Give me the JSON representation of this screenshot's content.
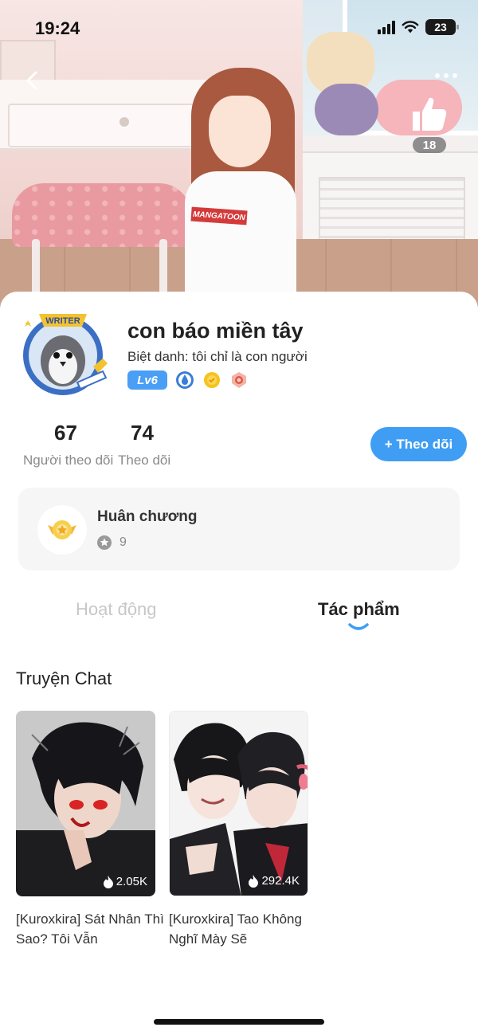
{
  "status_bar": {
    "time": "19:24",
    "battery": "23"
  },
  "header": {
    "like_count": "18"
  },
  "profile": {
    "name": "con báo miền tây",
    "alias": "Biệt danh: tôi chỉ là con người",
    "level": "Lv6",
    "avatar_badge": "WRITER",
    "shirt_text": "MANGATOON"
  },
  "stats": [
    {
      "value": "67",
      "label": "Người theo dõi"
    },
    {
      "value": "74",
      "label": "Theo dõi"
    }
  ],
  "follow_button": "+ Theo dõi",
  "medals": {
    "title": "Huân chương",
    "count": "9"
  },
  "tabs": [
    {
      "label": "Hoạt động",
      "active": false
    },
    {
      "label": "Tác phẩm",
      "active": true
    }
  ],
  "section": {
    "title": "Truyện Chat"
  },
  "works": [
    {
      "title": "[Kuroxkira] Sát Nhân Thì Sao? Tôi Vẫn",
      "views": "2.05K"
    },
    {
      "title": "[Kuroxkira] Tao Không Nghĩ Mày Sẽ",
      "views": "292.4K"
    }
  ],
  "colors": {
    "accent": "#3f9ef3",
    "level_badge": "#4a9ef5",
    "medal_card_bg": "#f6f6f7"
  }
}
